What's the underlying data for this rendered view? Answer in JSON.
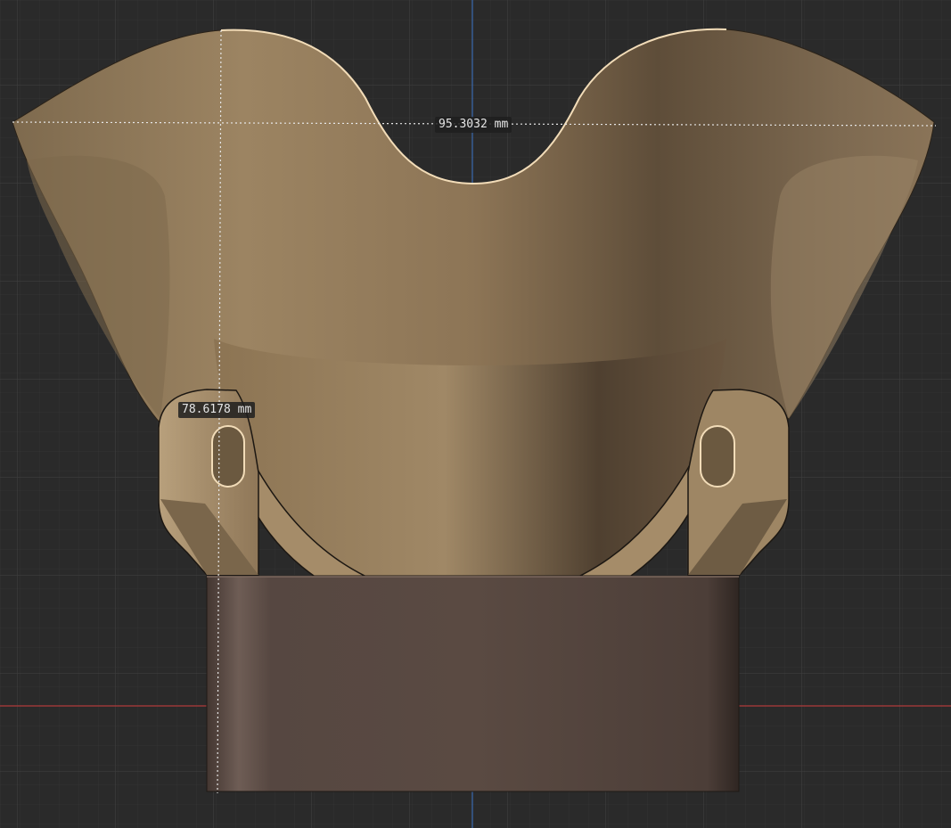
{
  "viewport": {
    "background_color": "#2a2a2a",
    "grid_minor_color": "#343434",
    "grid_major_color": "#3d3d3d",
    "x_axis_color": "#b03a3a",
    "y_axis_color": "#3a6ab0"
  },
  "model": {
    "body_color": "#8f7758",
    "body_edge_color": "#f2dcb8",
    "base_block_color": "#5a4a42"
  },
  "measurements": {
    "width": "95.3032 mm",
    "height": "78.6178 mm"
  }
}
